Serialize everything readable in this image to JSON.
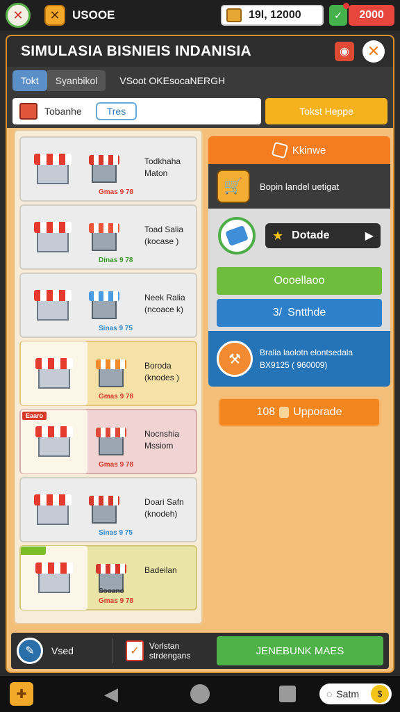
{
  "topbar": {
    "player_name": "USOOE",
    "money": "19l, 12000",
    "gems": "2000",
    "icons": [
      "avatar-icon",
      "swords-icon",
      "chest-icon",
      "gem-plus-icon"
    ]
  },
  "header": {
    "title": "SIMULASIA BISNIEIS INDANISIA"
  },
  "tabs": [
    {
      "label": "Tokt"
    },
    {
      "label": "Syanbikol"
    },
    {
      "label": "VSoot OKEsocaNERGH"
    }
  ],
  "filter": {
    "label": "Tobanhe",
    "chip": "Tres",
    "button": "Tokst Heppe"
  },
  "shops": [
    {
      "name": "Todkhaha Maton",
      "price": "Gmas 9 78",
      "price_color": "#d8372b",
      "style": "plain",
      "roof": "#d8372b"
    },
    {
      "name": "Toad Salia (kocase )",
      "price": "Dinas 9 78",
      "price_color": "#3a9a2a",
      "style": "plain",
      "roof": "#e8553a"
    },
    {
      "name": "Neek Ralia (ncoace k)",
      "price": "Sinas 9 75",
      "price_color": "#2f89c9",
      "style": "plain",
      "roof": "#4a9be0"
    },
    {
      "name": "Boroda (knodes )",
      "price": "Gmas 9 78",
      "price_color": "#d8372b",
      "style": "yellow",
      "roof": "#f08a2a"
    },
    {
      "name": "Nocnshia Mssiom",
      "price": "Gmas 9 78",
      "price_color": "#d8372b",
      "style": "pink",
      "roof": "#e0493a",
      "badge": "Eaaro"
    },
    {
      "name": "Doari Safn (knodeh)",
      "price": "Sinas 9 75",
      "price_color": "#2f89c9",
      "style": "plain",
      "roof": "#d8372b"
    },
    {
      "name": "Badeilan",
      "price": "Gmas 9 78",
      "price_color": "#d8372b",
      "style": "green",
      "roof": "#d8372b",
      "sub": "Sooano"
    }
  ],
  "right_panel": {
    "header": "Kkinwe",
    "dark_text": "Bopin landel uetigat",
    "decade_label": "Dotade",
    "green_button": "Oooellaoo",
    "blue_button": "Sntthde",
    "blue_prefix": "3/",
    "info_line1": "Bralia laolotn elontsedala",
    "info_line2": "BX9125 ( 960009)",
    "upgrade_prefix": "108",
    "upgrade_label": "Upporade"
  },
  "bottom_bar": {
    "left_label": "Vsed",
    "mid_line1": "Vorlstan",
    "mid_line2": "strdengans",
    "go_button": "JENEBUNK MAES"
  },
  "system_bar": {
    "chip_label": "Satm"
  }
}
